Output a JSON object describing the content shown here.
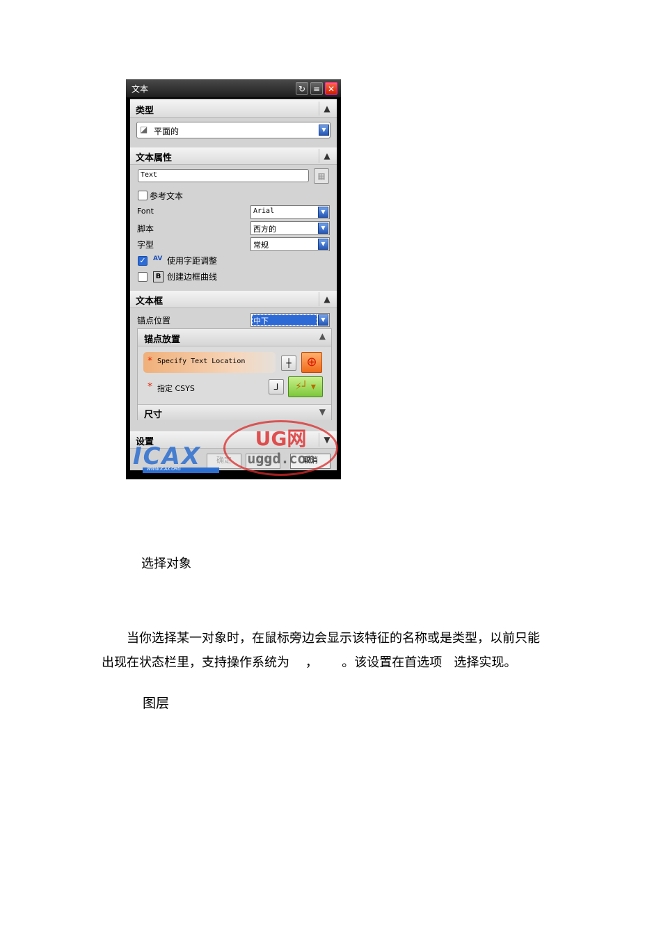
{
  "dialog": {
    "title": "文本",
    "sections": {
      "type": {
        "title": "类型",
        "combo_value": "平面的"
      },
      "text_props": {
        "title": "文本属性",
        "text_value": "Text",
        "ref_text_label": "参考文本",
        "font_label": "Font",
        "font_value": "Arial",
        "script_label": "脚本",
        "script_value": "西方的",
        "style_label": "字型",
        "style_value": "常规",
        "kerning_label": "使用字距调整",
        "kerning_icon_text": "AV",
        "border_label": "创建边框曲线",
        "border_icon_text": "B"
      },
      "text_frame": {
        "title": "文本框",
        "anchor_pos_label": "锚点位置",
        "anchor_pos_value": "中下",
        "anchor_place": {
          "title": "锚点放置",
          "specify_location": "Specify Text Location",
          "specify_csys": "指定 CSYS"
        },
        "dimension_title": "尺寸"
      },
      "settings": {
        "title": "设置"
      }
    },
    "buttons": {
      "ok": "确定",
      "apply": "应用",
      "cancel": "取消"
    },
    "watermark": {
      "brand": "ICAX",
      "site": "WWW.ICAX.ORG",
      "stamp_title": "UG网",
      "stamp_url": "uggd.com"
    }
  },
  "document": {
    "heading1": "选择对象",
    "paragraph_line1": "当你选择某一对象时，在鼠标旁边会显示该特征的名称或是类型，以前只能",
    "paragraph_line2": "出现在状态栏里，支持操作系统为    ，      。该设置在首选项   选择实现。",
    "heading2": "图层"
  }
}
